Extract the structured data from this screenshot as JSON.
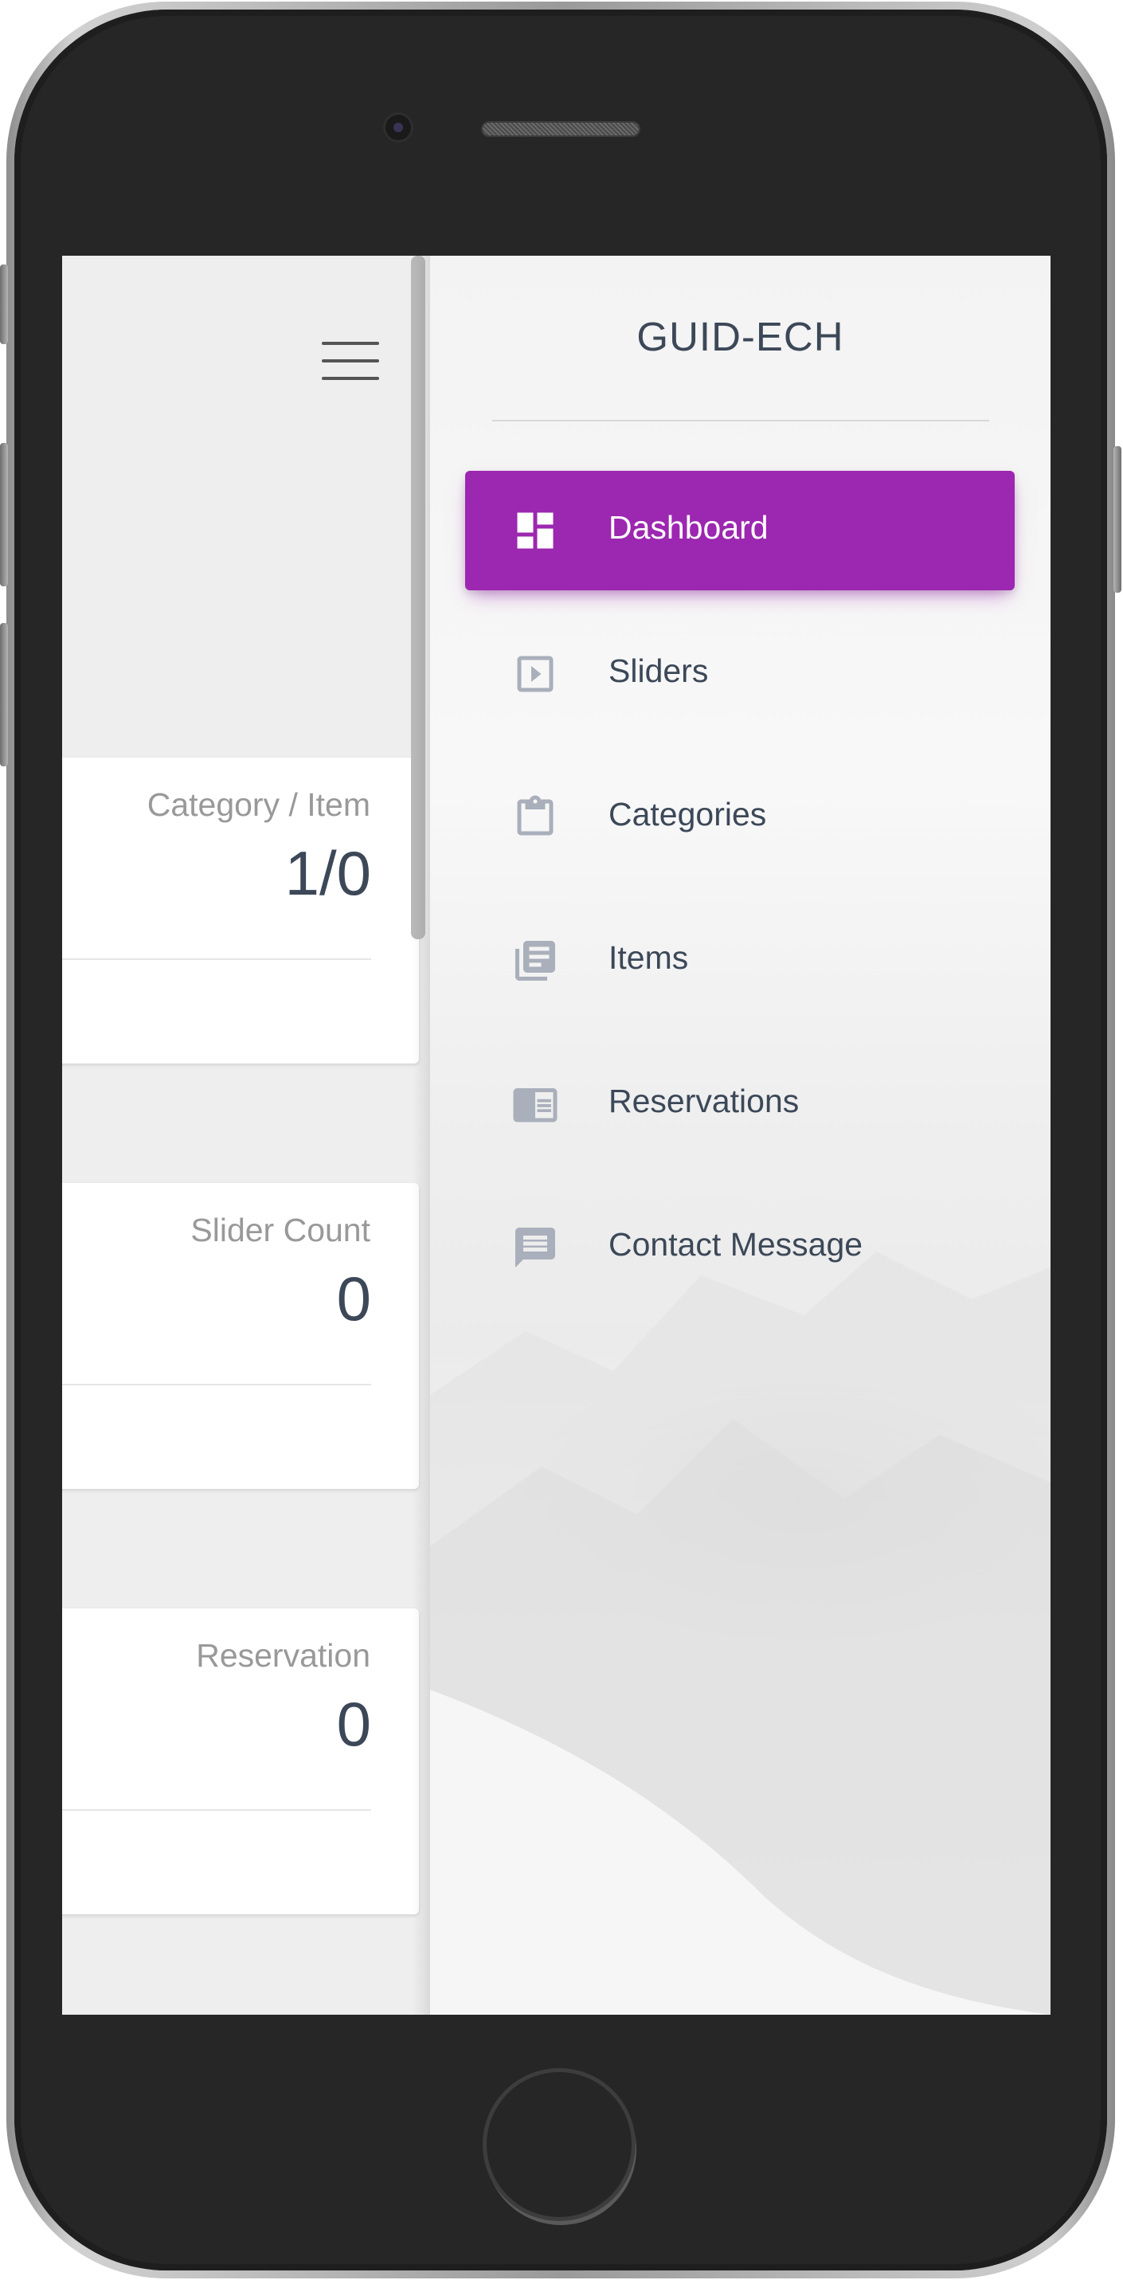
{
  "sidebar": {
    "brand": "GUID-ECH",
    "items": [
      {
        "label": "Dashboard",
        "icon": "dashboard-icon",
        "active": true
      },
      {
        "label": "Sliders",
        "icon": "slideshow-icon",
        "active": false
      },
      {
        "label": "Categories",
        "icon": "clipboard-icon",
        "active": false
      },
      {
        "label": "Items",
        "icon": "library-books-icon",
        "active": false
      },
      {
        "label": "Reservations",
        "icon": "chrome-reader-mode-icon",
        "active": false
      },
      {
        "label": "Contact Message",
        "icon": "message-icon",
        "active": false
      }
    ]
  },
  "main": {
    "menu_icon": "hamburger-menu-icon",
    "cards": [
      {
        "label": "Category / Item",
        "value": "1/0"
      },
      {
        "label": "Slider Count",
        "value": "0"
      },
      {
        "label": "Reservation",
        "value": "0"
      }
    ]
  },
  "colors": {
    "accent": "#9c27b0",
    "text": "#3c4858",
    "muted": "#999999",
    "icon_gray": "#a9afbb"
  }
}
